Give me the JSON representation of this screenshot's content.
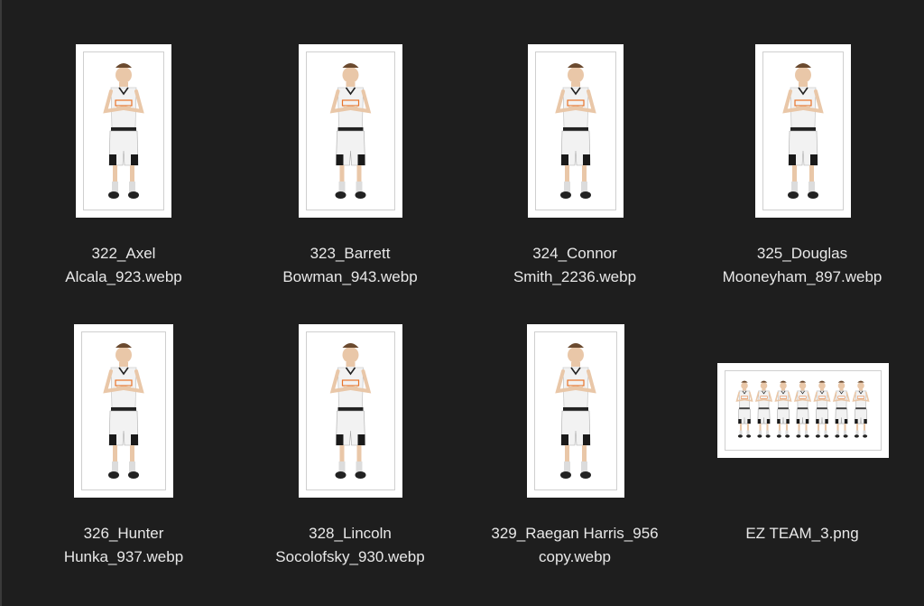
{
  "colors": {
    "background": "#1e1e1e",
    "label_text": "#e8e8e8",
    "thumb_bg": "#ffffff",
    "jersey": "#f2f2f2",
    "jersey_trim": "#e8742a",
    "shorts_accent": "#1a1a1a"
  },
  "files": [
    {
      "line1": "322_Axel",
      "line2": "Alcala_923.webp",
      "icon": "player-photo-icon"
    },
    {
      "line1": "323_Barrett",
      "line2": "Bowman_943.webp",
      "icon": "player-photo-icon"
    },
    {
      "line1": "324_Connor",
      "line2": "Smith_2236.webp",
      "icon": "player-photo-icon"
    },
    {
      "line1": "325_Douglas",
      "line2": "Mooneyham_897.webp",
      "icon": "player-photo-icon"
    },
    {
      "line1": "326_Hunter",
      "line2": "Hunka_937.webp",
      "icon": "player-photo-icon"
    },
    {
      "line1": "328_Lincoln",
      "line2": "Socolofsky_930.webp",
      "icon": "player-photo-icon"
    },
    {
      "line1": "329_Raegan Harris_956",
      "line2": "copy.webp",
      "icon": "player-photo-icon"
    },
    {
      "line1": "EZ TEAM_3.png",
      "line2": "",
      "icon": "team-photo-icon"
    }
  ]
}
